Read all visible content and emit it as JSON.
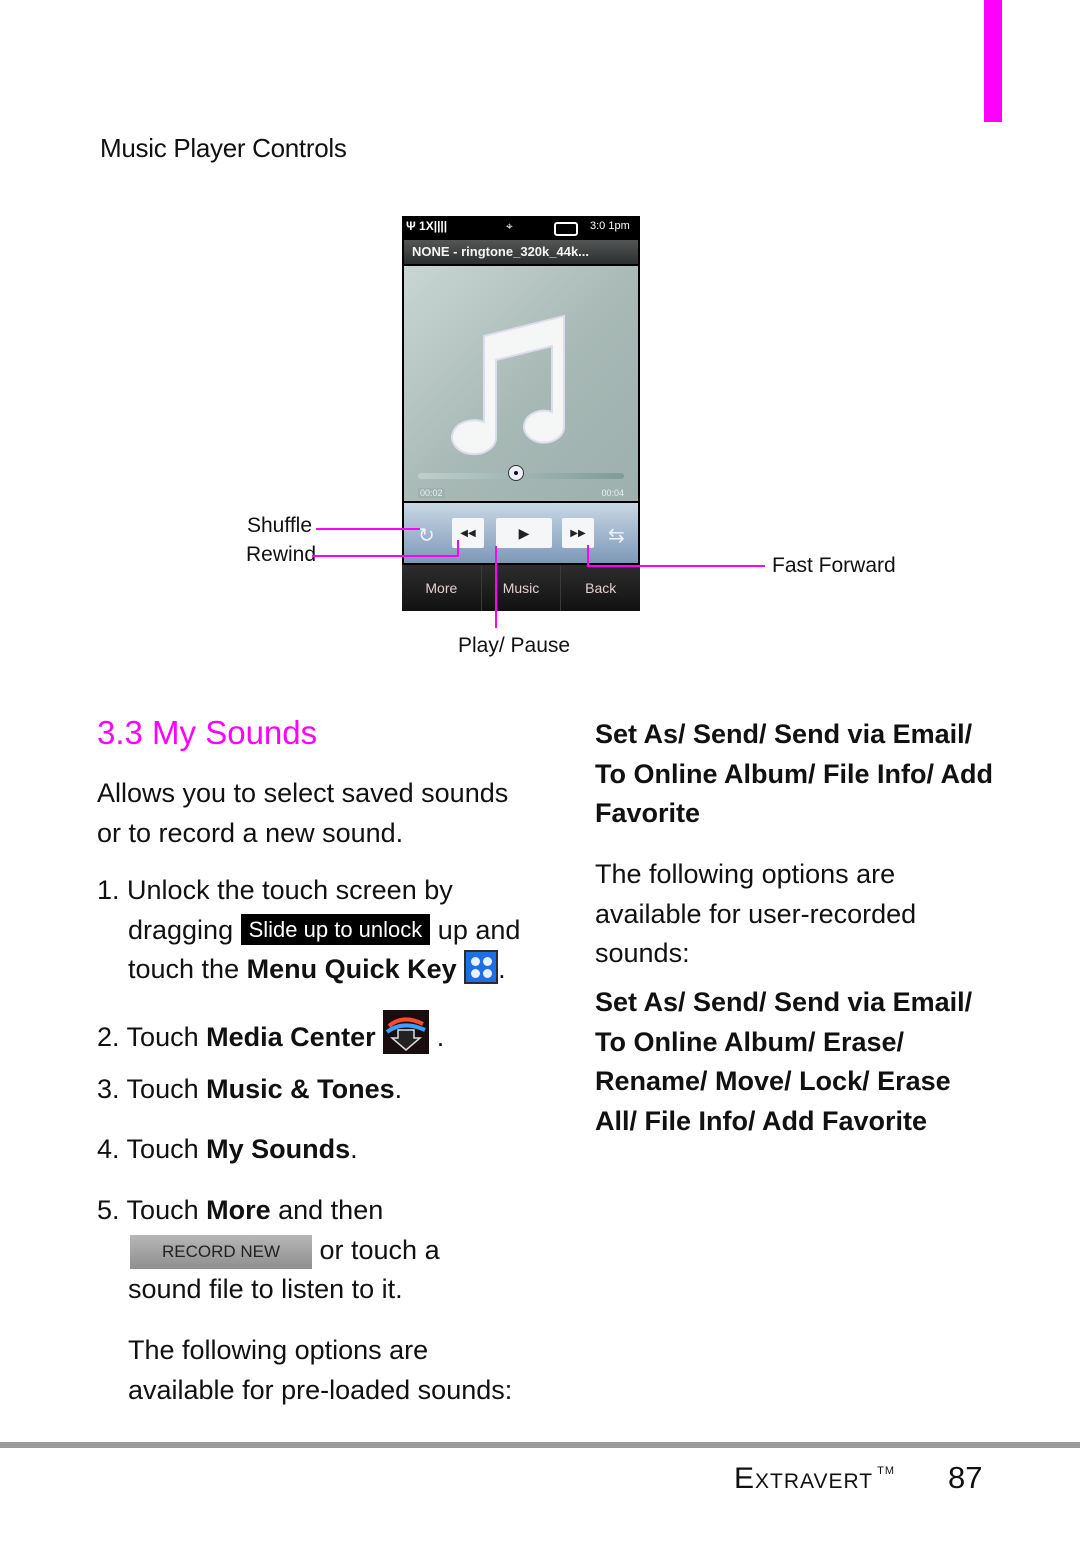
{
  "section": {
    "title": "Music Player Controls"
  },
  "phone": {
    "status": {
      "signal": "Ψ 1X||||",
      "gps": "⌖",
      "time": "3:0 1pm"
    },
    "track_title": "NONE - ringtone_320k_44k...",
    "time_start": "00:02",
    "time_end": "00:04",
    "progress_fraction": 0.5,
    "controls": {
      "shuffle": "↻",
      "rewind": "◀◀",
      "play": "▶",
      "fast_forward": "▶▶",
      "repeat": "⇆"
    },
    "softkeys": [
      "More",
      "Music",
      "Back"
    ]
  },
  "callouts": {
    "shuffle": "Shuffle",
    "rewind": "Rewind",
    "fast_forward": "Fast Forward",
    "play_pause": "Play/ Pause"
  },
  "heading": "3.3 My Sounds",
  "intro": [
    "Allows you to select saved sounds",
    "or to record a new sound."
  ],
  "steps": {
    "s1": {
      "num": "1.",
      "a": "Unlock the touch screen by",
      "b": "dragging",
      "chip": "Slide up to unlock",
      "c": "up and",
      "d": "touch the ",
      "bold": "Menu Quick Key",
      "end": "."
    },
    "s2": {
      "num": "2.",
      "a": "Touch ",
      "bold": "Media Center",
      "end": "."
    },
    "s3": {
      "num": "3.",
      "a": "Touch ",
      "bold": "Music & Tones",
      "end": "."
    },
    "s4": {
      "num": "4.",
      "a": "Touch ",
      "bold": "My Sounds",
      "end": "."
    },
    "s5": {
      "num": "5.",
      "a": "Touch ",
      "bold": "More",
      "b": " and then",
      "button": "RECORD NEW",
      "c": "or touch a",
      "d": "sound file to listen to it."
    }
  },
  "preloaded": [
    "The following options are",
    "available for pre-loaded sounds:"
  ],
  "preloaded_options": [
    "Set As/ Send/ Send via Email/",
    "To Online Album/ File Info/ Add",
    "Favorite"
  ],
  "recorded": [
    "The following options are",
    "available for user-recorded",
    "sounds:"
  ],
  "recorded_options": [
    "Set As/ Send/ Send via Email/",
    "To Online Album/ Erase/",
    "Rename/ Move/ Lock/ Erase",
    "All/ File Info/ Add Favorite"
  ],
  "footer": {
    "brand": "Extravert",
    "tm": "TM",
    "page": "87"
  },
  "colors": {
    "accent": "#ff00ff"
  }
}
